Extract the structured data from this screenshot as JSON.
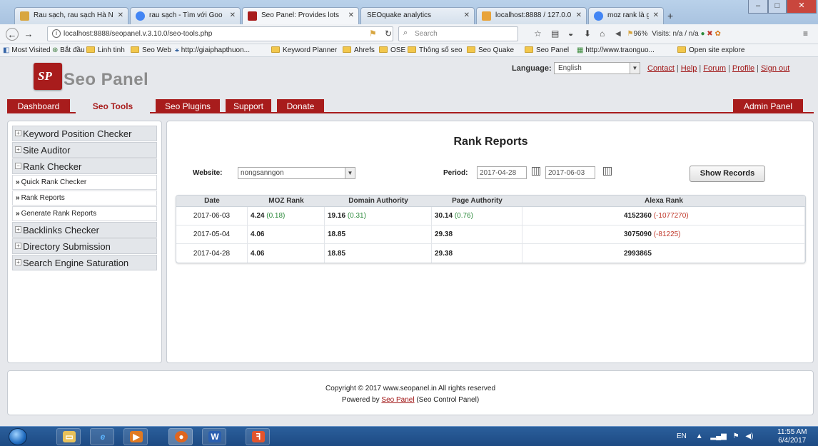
{
  "browser": {
    "tabs": [
      {
        "label": "Rau sạch, rau sạch Hà N",
        "favicon_color": "#d8a640"
      },
      {
        "label": "rau sạch - Tìm với Goo",
        "favicon_color": "#4285f4"
      },
      {
        "label": "Seo Panel: Provides lots",
        "favicon_color": "#a81c1c"
      },
      {
        "label": "SEOquake analytics",
        "favicon_color": ""
      },
      {
        "label": "localhost:8888 / 127.0.0",
        "favicon_color": "#e8a33a"
      },
      {
        "label": "moz rank là gì - Tìm với",
        "favicon_color": "#4285f4"
      }
    ],
    "url": "localhost:8888/seopanel.v.3.10.0/seo-tools.php",
    "search_placeholder": "Search",
    "zoom_text": "96%",
    "seoquake_text": "Visits: n/a / n/a",
    "bookmarks": [
      "Most Visited",
      "Bắt đầu",
      "Linh tinh",
      "Seo Web",
      "http://giaiphapthuon...",
      "Keyword Planner",
      "Ahrefs",
      "OSE",
      "Thông số seo",
      "Seo Quake",
      "Seo Panel",
      "http://www.traonguo...",
      "Open site explore"
    ]
  },
  "header": {
    "brand": "Seo Panel",
    "logo_mark": "SP",
    "language_label": "Language:",
    "language_value": "English",
    "links": [
      "Contact",
      "Help",
      "Forum",
      "Profile",
      "Sign out"
    ]
  },
  "menu": {
    "items": [
      "Dashboard",
      "Seo Tools",
      "Seo Plugins",
      "Support",
      "Donate"
    ],
    "admin": "Admin Panel"
  },
  "sidebar": {
    "groups": [
      {
        "label": "Keyword Position Checker",
        "expanded": false
      },
      {
        "label": "Site Auditor",
        "expanded": false
      },
      {
        "label": "Rank Checker",
        "expanded": true,
        "items": [
          "Quick Rank Checker",
          "Rank Reports",
          "Generate Rank Reports"
        ]
      },
      {
        "label": "Backlinks Checker",
        "expanded": false
      },
      {
        "label": "Directory Submission",
        "expanded": false
      },
      {
        "label": "Search Engine Saturation",
        "expanded": false
      }
    ]
  },
  "report": {
    "title": "Rank Reports",
    "website_label": "Website:",
    "website_value": "nongsanngon",
    "period_label": "Period:",
    "date_from": "2017-04-28",
    "date_to": "2017-06-03",
    "show_button": "Show Records",
    "columns": [
      "Date",
      "MOZ Rank",
      "Domain Authority",
      "Page Authority",
      "Alexa Rank"
    ],
    "rows": [
      {
        "date": "2017-06-03",
        "moz": "4.24",
        "moz_chg": "(0.18)",
        "da": "19.16",
        "da_chg": "(0.31)",
        "pa": "30.14",
        "pa_chg": "(0.76)",
        "alexa": "4152360",
        "alexa_chg": "(-1077270)"
      },
      {
        "date": "2017-05-04",
        "moz": "4.06",
        "moz_chg": "",
        "da": "18.85",
        "da_chg": "",
        "pa": "29.38",
        "pa_chg": "",
        "alexa": "3075090",
        "alexa_chg": "(-81225)"
      },
      {
        "date": "2017-04-28",
        "moz": "4.06",
        "moz_chg": "",
        "da": "18.85",
        "da_chg": "",
        "pa": "29.38",
        "pa_chg": "",
        "alexa": "2993865",
        "alexa_chg": ""
      }
    ]
  },
  "footer": {
    "copyright": "Copyright © 2017 www.seopanel.in All rights reserved",
    "powered_prefix": "Powered by",
    "powered_link": "Seo Panel",
    "powered_suffix": "(Seo Control Panel)"
  },
  "taskbar": {
    "lang": "EN",
    "time": "11:55 AM",
    "date": "6/4/2017"
  },
  "colors": {
    "brand_red": "#a81c1c",
    "positive": "#2c8a3c",
    "negative": "#c0392b"
  }
}
